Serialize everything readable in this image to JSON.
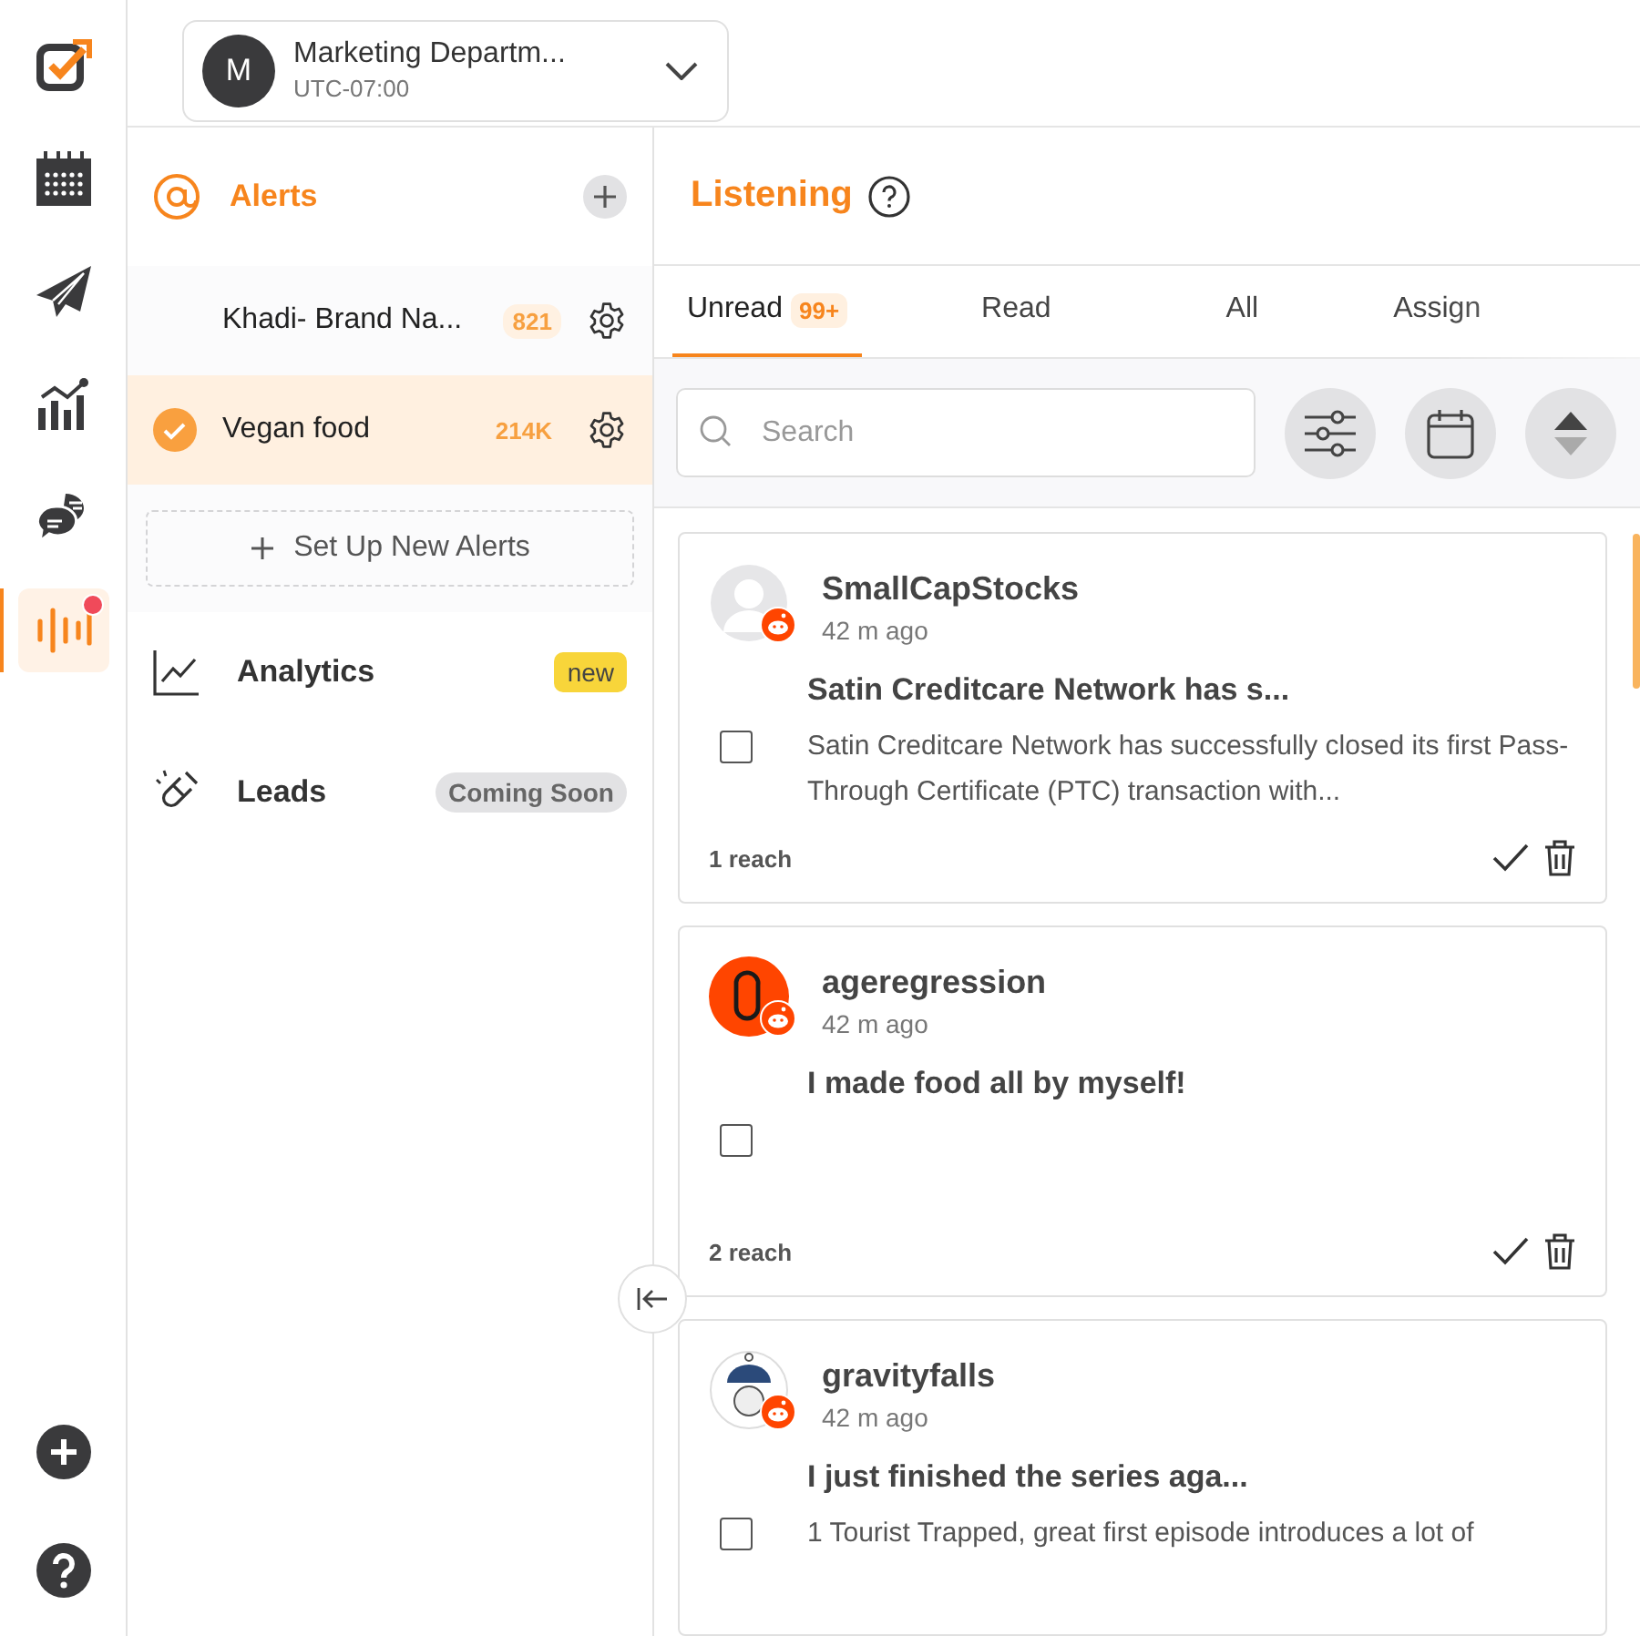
{
  "rail": {
    "items": [
      {
        "kind": "logo",
        "selected": false
      },
      {
        "kind": "calendar",
        "selected": false
      },
      {
        "kind": "send",
        "selected": false
      },
      {
        "kind": "analytics",
        "selected": false
      },
      {
        "kind": "chat",
        "selected": false
      },
      {
        "kind": "listening",
        "selected": true,
        "notification": true
      }
    ],
    "bottom": [
      {
        "kind": "add"
      },
      {
        "kind": "help"
      }
    ]
  },
  "workspace": {
    "initial": "M",
    "name": "Marketing Departm...",
    "timezone": "UTC-07:00"
  },
  "sidebar": {
    "alerts": {
      "title": "Alerts",
      "items": [
        {
          "name": "Khadi- Brand Na...",
          "count": "821",
          "selected": false
        },
        {
          "name": "Vegan food",
          "count": "214K",
          "selected": true
        }
      ],
      "add_button": "Set Up New Alerts"
    },
    "sections": [
      {
        "kind": "analytics",
        "label": "Analytics",
        "badge": "new"
      },
      {
        "kind": "leads",
        "label": "Leads",
        "badge": "Coming Soon"
      }
    ]
  },
  "main": {
    "title": "Listening",
    "tabs": [
      {
        "label": "Unread",
        "badge": "99+",
        "selected": true
      },
      {
        "label": "Read",
        "selected": false
      },
      {
        "label": "All",
        "selected": false
      },
      {
        "label": "Assign",
        "selected": false
      }
    ],
    "search": {
      "placeholder": "Search"
    },
    "posts": [
      {
        "author": "SmallCapStocks",
        "time": "42 m ago",
        "kind": "default",
        "title": "Satin Creditcare Network has s...",
        "body": "Satin Creditcare Network has successfully closed its first Pass-Through Certificate (PTC) transaction with...",
        "checked": false,
        "reach": "1 reach"
      },
      {
        "author": "ageregression",
        "time": "42 m ago",
        "kind": "orange",
        "title": "I made food all by myself!",
        "checked": false,
        "reach": "2 reach"
      },
      {
        "author": "gravityfalls",
        "time": "42 m ago",
        "kind": "cartoon",
        "title": "I just finished the series aga...",
        "body": "1 Tourist Trapped, great first episode introduces a lot of",
        "checked": false
      }
    ]
  }
}
